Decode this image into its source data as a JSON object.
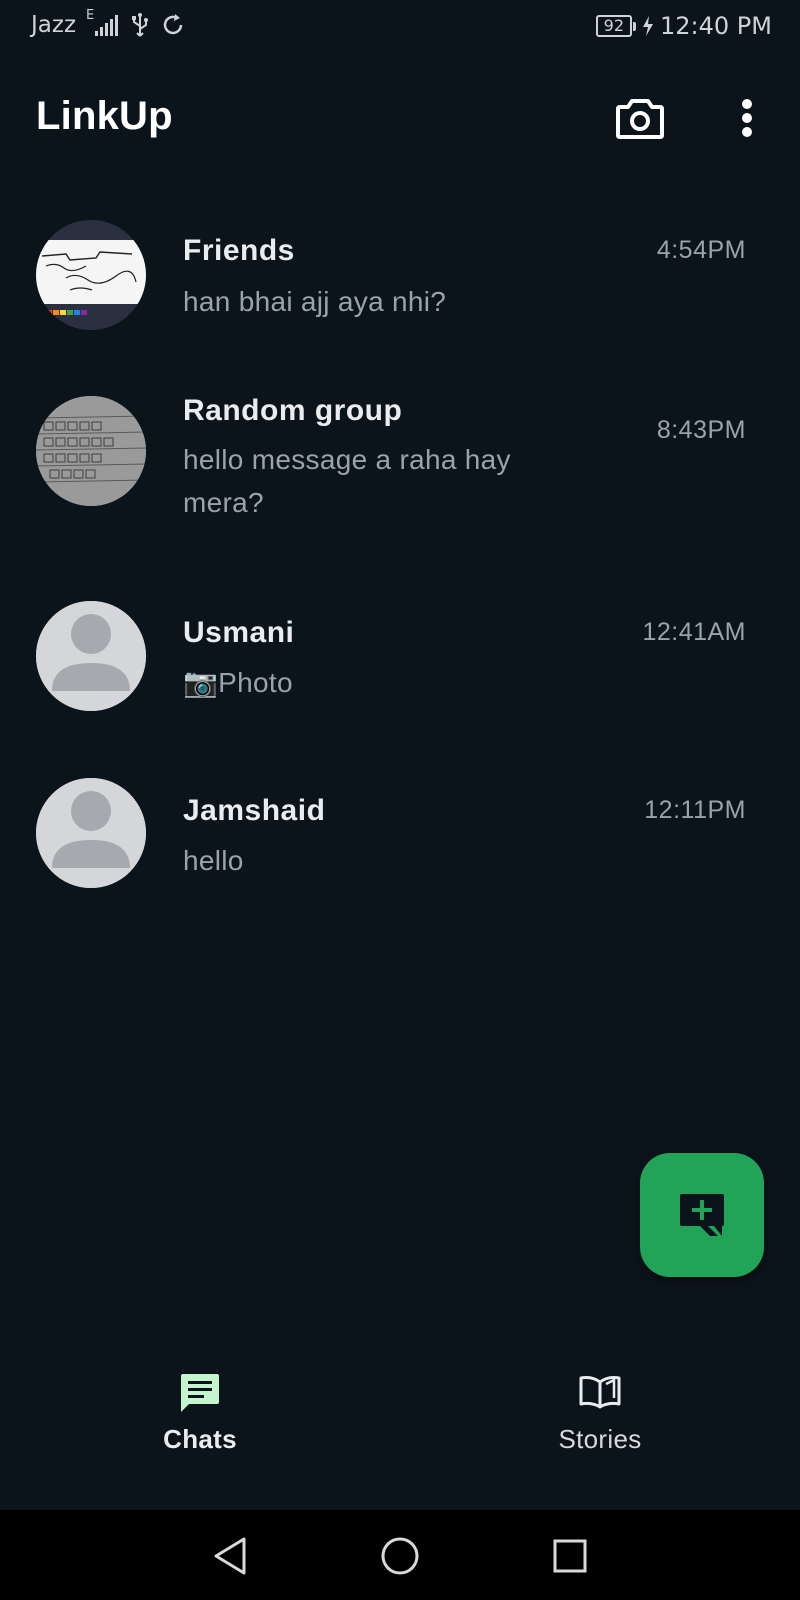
{
  "status_bar": {
    "carrier": "Jazz",
    "network_type": "E",
    "battery_level": "92",
    "time": "12:40 PM",
    "icons": [
      "signal-icon",
      "usb-icon",
      "sync-icon",
      "battery-icon",
      "charging-icon"
    ]
  },
  "app_bar": {
    "title": "LinkUp",
    "actions": [
      "camera-icon",
      "more-vert-icon"
    ]
  },
  "chats": [
    {
      "name": "Friends",
      "message": "han bhai ajj aya nhi?",
      "time": "4:54PM",
      "avatar": "photo-whiteboard"
    },
    {
      "name": "Random group",
      "message": "hello message a raha hay mera?",
      "time": "8:43PM",
      "avatar": "photo-notebook"
    },
    {
      "name": "Usmani",
      "message": "📷Photo",
      "time": "12:41AM",
      "avatar": "default-person-icon"
    },
    {
      "name": "Jamshaid",
      "message": "hello",
      "time": "12:11PM",
      "avatar": "default-person-icon"
    }
  ],
  "fab": {
    "icon": "new-chat-icon",
    "color": "#21a358"
  },
  "bottom_nav": {
    "items": [
      {
        "label": "Chats",
        "icon": "chat-icon",
        "active": true
      },
      {
        "label": "Stories",
        "icon": "book-open-icon",
        "active": false
      }
    ]
  },
  "system_nav": {
    "buttons": [
      "back-icon",
      "home-icon",
      "recents-icon"
    ]
  },
  "colors": {
    "background": "#0b131b",
    "accent": "#21a358",
    "active_nav_icon": "#c4f5cf"
  }
}
